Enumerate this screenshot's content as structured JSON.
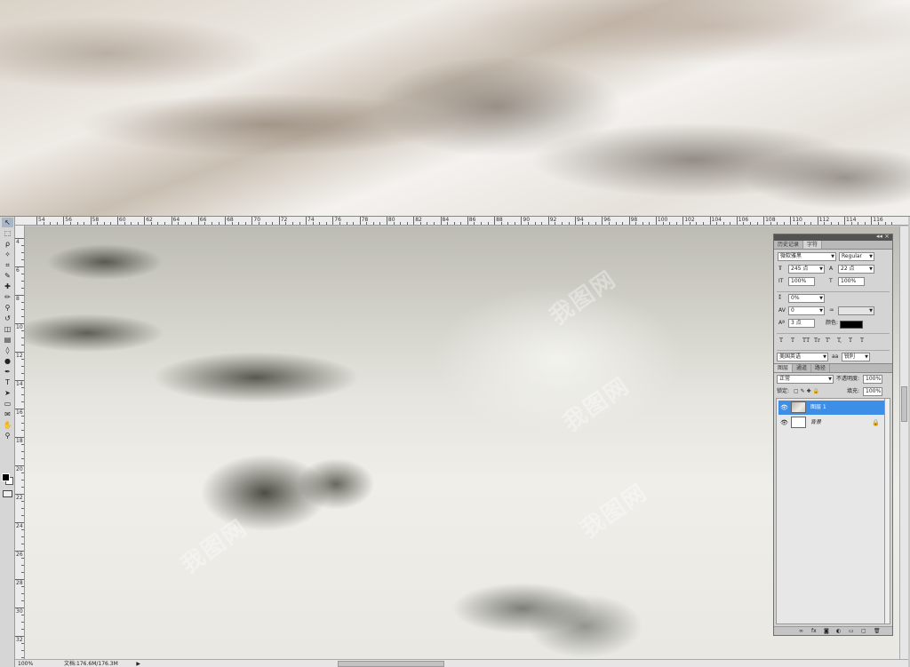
{
  "ruler": {
    "top_labels": [
      "54",
      "56",
      "58",
      "60",
      "62",
      "64",
      "66",
      "68",
      "70",
      "72",
      "74",
      "76",
      "78",
      "80",
      "82",
      "84",
      "86",
      "88",
      "90",
      "92",
      "94",
      "96",
      "98",
      "100",
      "102",
      "104",
      "106",
      "108",
      "110",
      "112",
      "114",
      "116"
    ],
    "left_labels": [
      "4",
      "6",
      "8",
      "10",
      "12",
      "14",
      "16",
      "18",
      "20",
      "22",
      "24",
      "26",
      "28",
      "30",
      "32"
    ]
  },
  "watermark": "我图网",
  "status": {
    "zoom": "100%",
    "doc_size": "文档:176.6M/176.3M",
    "arrow": "▶"
  },
  "toolbox": {
    "tools": [
      {
        "name": "move-tool",
        "glyph": "↖"
      },
      {
        "name": "marquee-tool",
        "glyph": "⬚"
      },
      {
        "name": "lasso-tool",
        "glyph": "ρ"
      },
      {
        "name": "magic-wand-tool",
        "glyph": "✧"
      },
      {
        "name": "crop-tool",
        "glyph": "⌗"
      },
      {
        "name": "eyedropper-tool",
        "glyph": "✎"
      },
      {
        "name": "healing-brush-tool",
        "glyph": "✚"
      },
      {
        "name": "brush-tool",
        "glyph": "✏"
      },
      {
        "name": "clone-stamp-tool",
        "glyph": "⚲"
      },
      {
        "name": "history-brush-tool",
        "glyph": "↺"
      },
      {
        "name": "eraser-tool",
        "glyph": "◫"
      },
      {
        "name": "gradient-tool",
        "glyph": "▤"
      },
      {
        "name": "blur-tool",
        "glyph": "◊"
      },
      {
        "name": "dodge-tool",
        "glyph": "●"
      },
      {
        "name": "pen-tool",
        "glyph": "✒"
      },
      {
        "name": "type-tool",
        "glyph": "T"
      },
      {
        "name": "path-selection-tool",
        "glyph": "➤"
      },
      {
        "name": "shape-tool",
        "glyph": "▭"
      },
      {
        "name": "notes-tool",
        "glyph": "✉"
      },
      {
        "name": "hand-tool",
        "glyph": "✋"
      },
      {
        "name": "zoom-tool",
        "glyph": "⚲"
      }
    ]
  },
  "panel": {
    "tabs": [
      "历史记录",
      "字符"
    ],
    "font_family": "微软雅黑",
    "font_style": "Regular",
    "font_size": "245 点",
    "leading": "22 点",
    "vertical_scale": "100%",
    "horizontal_scale": "100%",
    "kerning": "0%",
    "tracking": "0",
    "baseline_shift": "3 点",
    "color_label": "颜色:",
    "style_buttons": [
      "T",
      "T",
      "TT",
      "Tr",
      "T'",
      "T,",
      "T",
      "T"
    ],
    "language": "美国英语",
    "antialias_prefix": "aa",
    "antialias": "锐利"
  },
  "layers": {
    "tabs": [
      "图层",
      "通道",
      "路径"
    ],
    "blend_mode": "正常",
    "opacity_label": "不透明度:",
    "opacity": "100%",
    "lock_label": "锁定:",
    "fill_label": "填充:",
    "fill": "100%",
    "items": [
      {
        "name": "图层 1",
        "selected": true
      },
      {
        "name": "背景",
        "selected": false,
        "locked": true
      }
    ],
    "footer_icons": [
      "∞",
      "fx",
      "◙",
      "◐",
      "▭",
      "▢",
      "🗑"
    ]
  },
  "colors": {
    "selection": "#3d8ee6",
    "panel_bg": "#d4d4d4"
  }
}
